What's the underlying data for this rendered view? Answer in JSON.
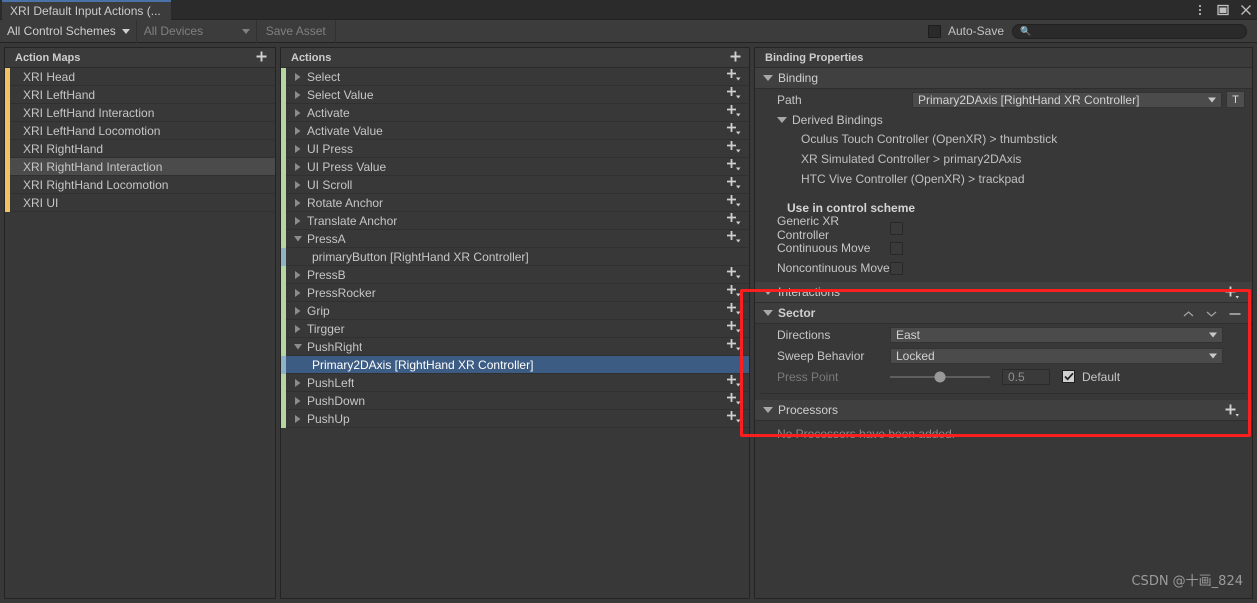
{
  "window": {
    "tab_title": "XRI Default Input Actions (...",
    "menu_icon": "kebab-menu-icon",
    "maximize_icon": "maximize-icon",
    "close_icon": "close-icon"
  },
  "toolbar": {
    "control_schemes": "All Control Schemes",
    "devices": "All Devices",
    "save_asset": "Save Asset",
    "autosave_label": "Auto-Save",
    "autosave_checked": false,
    "search_placeholder": "",
    "search_value": "",
    "search_icon": "search-icon"
  },
  "action_maps": {
    "header": "Action Maps",
    "add_icon": "plus-icon",
    "accent_color": "#f0c462",
    "items": [
      {
        "label": "XRI Head",
        "selected": false
      },
      {
        "label": "XRI LeftHand",
        "selected": false
      },
      {
        "label": "XRI LeftHand Interaction",
        "selected": false
      },
      {
        "label": "XRI LeftHand Locomotion",
        "selected": false
      },
      {
        "label": "XRI RightHand",
        "selected": false
      },
      {
        "label": "XRI RightHand Interaction",
        "selected": true
      },
      {
        "label": "XRI RightHand Locomotion",
        "selected": false
      },
      {
        "label": "XRI UI",
        "selected": false
      }
    ]
  },
  "actions": {
    "header": "Actions",
    "add_icon": "plus-icon",
    "action_accent_color": "#b5d6a0",
    "binding_accent_color": "#8fb3c4",
    "selection_color": "#3c5c84",
    "items": [
      {
        "label": "Select",
        "type": "action",
        "expanded": false,
        "selected": false
      },
      {
        "label": "Select Value",
        "type": "action",
        "expanded": false,
        "selected": false
      },
      {
        "label": "Activate",
        "type": "action",
        "expanded": false,
        "selected": false
      },
      {
        "label": "Activate Value",
        "type": "action",
        "expanded": false,
        "selected": false
      },
      {
        "label": "UI Press",
        "type": "action",
        "expanded": false,
        "selected": false
      },
      {
        "label": "UI Press Value",
        "type": "action",
        "expanded": false,
        "selected": false
      },
      {
        "label": "UI Scroll",
        "type": "action",
        "expanded": false,
        "selected": false
      },
      {
        "label": "Rotate Anchor",
        "type": "action",
        "expanded": false,
        "selected": false
      },
      {
        "label": "Translate Anchor",
        "type": "action",
        "expanded": false,
        "selected": false
      },
      {
        "label": "PressA",
        "type": "action",
        "expanded": true,
        "selected": false
      },
      {
        "label": "primaryButton [RightHand XR Controller]",
        "type": "binding",
        "expanded": false,
        "selected": false
      },
      {
        "label": "PressB",
        "type": "action",
        "expanded": false,
        "selected": false
      },
      {
        "label": "PressRocker",
        "type": "action",
        "expanded": false,
        "selected": false
      },
      {
        "label": "Grip",
        "type": "action",
        "expanded": false,
        "selected": false
      },
      {
        "label": "Tirgger",
        "type": "action",
        "expanded": false,
        "selected": false
      },
      {
        "label": "PushRight",
        "type": "action",
        "expanded": true,
        "selected": false
      },
      {
        "label": "Primary2DAxis [RightHand XR Controller]",
        "type": "binding",
        "expanded": false,
        "selected": true
      },
      {
        "label": "PushLeft",
        "type": "action",
        "expanded": false,
        "selected": false
      },
      {
        "label": "PushDown",
        "type": "action",
        "expanded": false,
        "selected": false
      },
      {
        "label": "PushUp",
        "type": "action",
        "expanded": false,
        "selected": false
      }
    ]
  },
  "binding_properties": {
    "header": "Binding Properties",
    "binding_section": {
      "title": "Binding",
      "path_label": "Path",
      "path_value": "Primary2DAxis [RightHand XR Controller]",
      "t_button": "T",
      "derived_title": "Derived Bindings",
      "derived": [
        "Oculus Touch Controller (OpenXR) > thumbstick",
        "XR Simulated Controller > primary2DAxis",
        "HTC Vive Controller (OpenXR) > trackpad"
      ],
      "scheme_title": "Use in control scheme",
      "schemes": [
        {
          "label": "Generic XR Controller",
          "checked": false
        },
        {
          "label": "Continuous Move",
          "checked": false
        },
        {
          "label": "Noncontinuous Move",
          "checked": false
        }
      ]
    },
    "interactions": {
      "title": "Interactions",
      "add_icon": "plus-dropdown-icon",
      "entry": {
        "title": "Sector",
        "move_up_icon": "chevron-up-icon",
        "move_down_icon": "chevron-down-icon",
        "remove_icon": "minus-icon",
        "fields": [
          {
            "label": "Directions",
            "value": "East",
            "kind": "dropdown",
            "dim": false
          },
          {
            "label": "Sweep Behavior",
            "value": "Locked",
            "kind": "dropdown",
            "dim": false
          }
        ],
        "press_point": {
          "label": "Press Point",
          "value": "0.5",
          "slider_fraction": 0.5,
          "default_label": "Default",
          "default_checked": true,
          "dim": true
        }
      }
    },
    "processors": {
      "title": "Processors",
      "add_icon": "plus-dropdown-icon",
      "empty_message": "No Processors have been added."
    }
  },
  "annotation": {
    "highlight_color": "#fb1f1f"
  },
  "watermark": "CSDN @十画_824"
}
